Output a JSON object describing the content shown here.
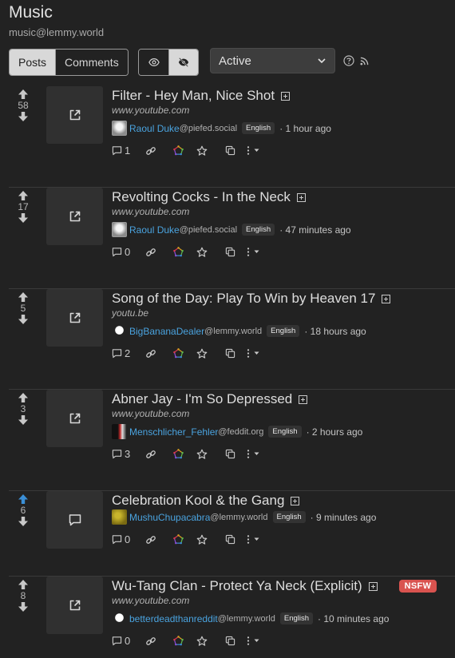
{
  "community": {
    "title": "Music",
    "handle": "music@lemmy.world"
  },
  "toolbar": {
    "posts_label": "Posts",
    "comments_label": "Comments",
    "sort_label": "Active"
  },
  "posts": [
    {
      "title": "Filter - Hey Man, Nice Shot",
      "domain": "www.youtube.com",
      "score": "58",
      "author": "Raoul Duke",
      "instance": "@piefed.social",
      "language": "English",
      "time": "· 1 hour ago",
      "comments": "1",
      "thumbnail": "external-link-icon",
      "upvoted": false,
      "nsfw": "",
      "avatar": "raoul"
    },
    {
      "title": "Revolting Cocks - In the Neck",
      "domain": "www.youtube.com",
      "score": "17",
      "author": "Raoul Duke",
      "instance": "@piefed.social",
      "language": "English",
      "time": "· 47 minutes ago",
      "comments": "0",
      "thumbnail": "external-link-icon",
      "upvoted": false,
      "nsfw": "",
      "avatar": "raoul"
    },
    {
      "title": "Song of the Day: Play To Win by Heaven 17",
      "domain": "youtu.be",
      "score": "5",
      "author": "BigBananaDealer",
      "instance": "@lemmy.world",
      "language": "English",
      "time": "· 18 hours ago",
      "comments": "2",
      "thumbnail": "external-link-icon",
      "upvoted": false,
      "nsfw": "",
      "avatar": "skull"
    },
    {
      "title": "Abner Jay - I'm So Depressed",
      "domain": "www.youtube.com",
      "score": "3",
      "author": "Menschlicher_Fehler",
      "instance": "@feddit.org",
      "language": "English",
      "time": "· 2 hours ago",
      "comments": "3",
      "thumbnail": "external-link-icon",
      "upvoted": false,
      "nsfw": "",
      "avatar": "face"
    },
    {
      "title": "Celebration Kool & the Gang",
      "domain": "",
      "score": "6",
      "author": "MushuChupacabra",
      "instance": "@lemmy.world",
      "language": "English",
      "time": "· 9 minutes ago",
      "comments": "0",
      "thumbnail": "comment-icon",
      "upvoted": true,
      "nsfw": "",
      "avatar": "mushu"
    },
    {
      "title": "Wu-Tang Clan - Protect Ya Neck (Explicit)",
      "domain": "www.youtube.com",
      "score": "8",
      "author": "betterdeadthanreddit",
      "instance": "@lemmy.world",
      "language": "English",
      "time": "· 10 minutes ago",
      "comments": "0",
      "thumbnail": "external-link-icon",
      "upvoted": false,
      "nsfw": "NSFW",
      "avatar": "skull"
    }
  ],
  "colors": {
    "background": "#222222",
    "accent_link": "#4aa3df",
    "upvote_active": "#3b8fd6",
    "nsfw": "#d9534f"
  }
}
